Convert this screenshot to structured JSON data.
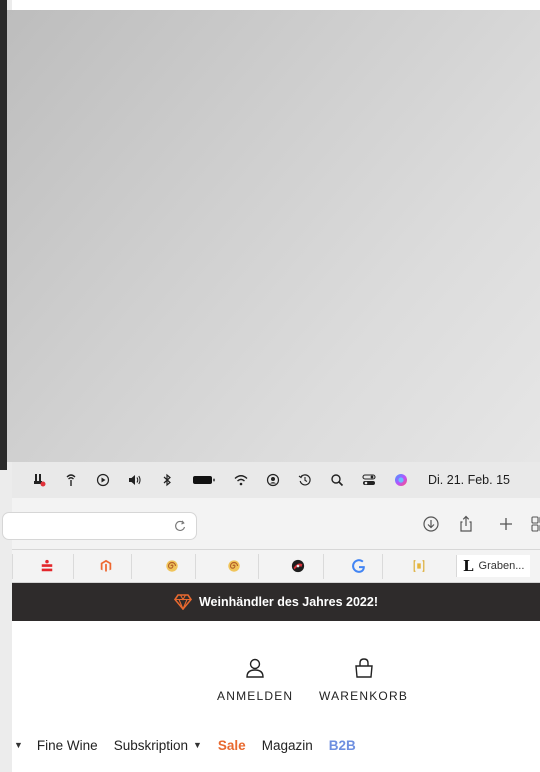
{
  "menubar": {
    "clock": "Di. 21. Feb. 15",
    "icons": [
      "app-icon",
      "antenna-icon",
      "play-icon",
      "volume-icon",
      "bluetooth-icon",
      "battery-icon",
      "wifi-icon",
      "user-icon",
      "time-machine-icon",
      "spotlight-search-icon",
      "control-center-icon",
      "siri-icon"
    ]
  },
  "favorites": {
    "last_label": "Graben...",
    "last_letter": "L"
  },
  "promo": {
    "text": "Weinhändler des Jahres 2022!",
    "accent": "#e8692f"
  },
  "header": {
    "login_label": "ANMELDEN",
    "cart_label": "WARENKORB"
  },
  "nav": {
    "items": [
      {
        "label": "Fine Wine"
      },
      {
        "label": "Subskription"
      },
      {
        "label": "Sale"
      },
      {
        "label": "Magazin"
      },
      {
        "label": "B2B"
      }
    ]
  },
  "colors": {
    "sale": "#e8692f",
    "b2b": "#6e8fe0",
    "banner": "#2e2b2b"
  }
}
